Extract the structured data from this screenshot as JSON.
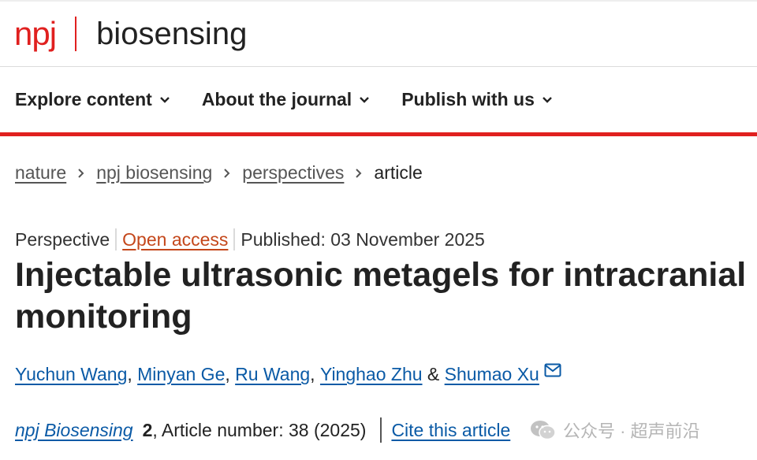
{
  "header": {
    "logo_npj": "npj",
    "logo_journal": "biosensing"
  },
  "nav": {
    "items": [
      {
        "label": "Explore content"
      },
      {
        "label": "About the journal"
      },
      {
        "label": "Publish with us"
      }
    ]
  },
  "breadcrumb": {
    "items": [
      "nature",
      "npj biosensing",
      "perspectives"
    ],
    "current": "article"
  },
  "article": {
    "type": "Perspective",
    "access": "Open access",
    "published": "Published: 03 November 2025",
    "title": "Injectable ultrasonic metagels for intracranial monitoring",
    "authors": [
      "Yuchun Wang",
      "Minyan Ge",
      "Ru Wang",
      "Yinghao Zhu",
      "Shumao Xu"
    ],
    "author_separators": [
      ", ",
      ", ",
      ", ",
      " & "
    ],
    "citation": {
      "journal": "npj Biosensing",
      "volume": "2",
      "rest": ", Article number: 38 (2025)",
      "cite_label": "Cite this article"
    }
  },
  "watermark": {
    "text": "公众号 · 超声前沿"
  },
  "colors": {
    "brand_red": "#e0201f",
    "link_blue": "#0a5aa6",
    "open_access_orange": "#c4471b"
  },
  "icons": [
    "chevron-down-icon",
    "chevron-right-icon",
    "envelope-icon",
    "wechat-icon"
  ]
}
